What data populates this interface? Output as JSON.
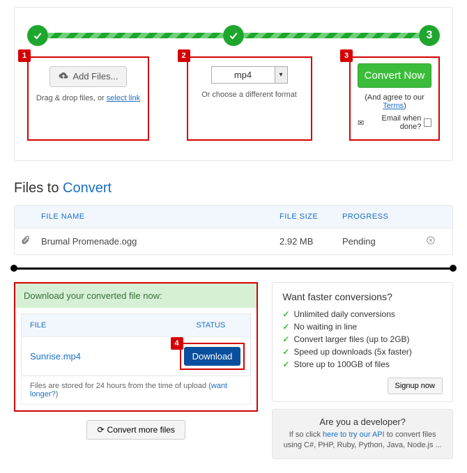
{
  "steps": {
    "step3_number": "3",
    "box1": {
      "num": "1",
      "add_label": "Add Files...",
      "sub_prefix": "Drag & drop files, or ",
      "sub_link": "select link"
    },
    "box2": {
      "num": "2",
      "format": "mp4",
      "sub": "Or choose a different format"
    },
    "box3": {
      "num": "3",
      "convert_label": "Convert Now",
      "agree_prefix": "(And agree to our ",
      "agree_link": "Terms",
      "agree_suffix": ")",
      "email_label": "Email when done?"
    }
  },
  "files_heading": {
    "prefix": "Files to ",
    "accent": "Convert"
  },
  "table": {
    "headers": {
      "name": "FILE NAME",
      "size": "FILE SIZE",
      "progress": "PROGRESS"
    },
    "row": {
      "name": "Brumal Promenade.ogg",
      "size": "2.92 MB",
      "progress": "Pending"
    }
  },
  "download": {
    "banner": "Download your converted file now:",
    "headers": {
      "file": "FILE",
      "status": "STATUS"
    },
    "file_name": "Sunrise.mp4",
    "num4": "4",
    "button": "Download",
    "stored_prefix": "Files are stored for 24 hours from the time of upload (",
    "stored_link": "want longer?",
    "stored_suffix": ")",
    "more_label": "Convert more files"
  },
  "promo": {
    "title": "Want faster conversions?",
    "items": [
      "Unlimited daily conversions",
      "No waiting in line",
      "Convert larger files (up to 2GB)",
      "Speed up downloads (5x faster)",
      "Store up to 100GB of files"
    ],
    "signup": "Signup now"
  },
  "dev": {
    "title": "Are you a developer?",
    "line_prefix": "If so click ",
    "line_link": "here to try our API",
    "line_suffix": " to convert files using C#, PHP, Ruby, Python, Java, Node.js ..."
  }
}
